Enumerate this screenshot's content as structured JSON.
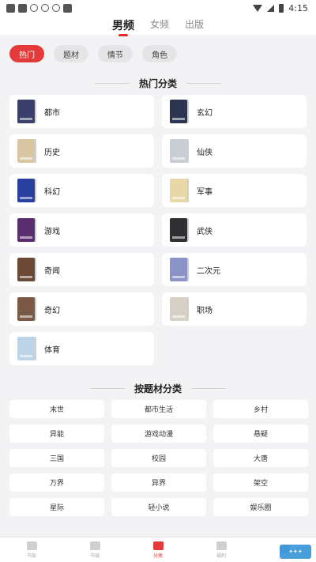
{
  "status_bar": {
    "time": "4:15"
  },
  "top_tabs": [
    {
      "label": "男频",
      "active": true
    },
    {
      "label": "女频",
      "active": false
    },
    {
      "label": "出版",
      "active": false
    }
  ],
  "filter_chips": [
    {
      "label": "热门",
      "active": true
    },
    {
      "label": "题材",
      "active": false
    },
    {
      "label": "情节",
      "active": false
    },
    {
      "label": "角色",
      "active": false
    }
  ],
  "hot_section": {
    "title": "热门分类",
    "items": [
      {
        "label": "都市",
        "cover_color": "#3a3f6b"
      },
      {
        "label": "玄幻",
        "cover_color": "#2c3550"
      },
      {
        "label": "历史",
        "cover_color": "#d9c7a3"
      },
      {
        "label": "仙侠",
        "cover_color": "#c9cdd4"
      },
      {
        "label": "科幻",
        "cover_color": "#2b3f9e"
      },
      {
        "label": "军事",
        "cover_color": "#e8d8a6"
      },
      {
        "label": "游戏",
        "cover_color": "#5a2d6e"
      },
      {
        "label": "武侠",
        "cover_color": "#2e2e33"
      },
      {
        "label": "奇闻",
        "cover_color": "#6a4a36"
      },
      {
        "label": "二次元",
        "cover_color": "#8b92c8"
      },
      {
        "label": "奇幻",
        "cover_color": "#7a5a46"
      },
      {
        "label": "职场",
        "cover_color": "#d6d0c6"
      },
      {
        "label": "体育",
        "cover_color": "#bcd4e6"
      }
    ]
  },
  "theme_section": {
    "title": "按题材分类",
    "items": [
      "末世",
      "都市生活",
      "乡村",
      "异能",
      "游戏动漫",
      "悬疑",
      "三国",
      "校园",
      "大唐",
      "万界",
      "异界",
      "架空",
      "星际",
      "轻小说",
      "娱乐圈"
    ]
  },
  "bottom_nav": [
    {
      "label": "书架",
      "active": false
    },
    {
      "label": "书城",
      "active": false
    },
    {
      "label": "分类",
      "active": true
    },
    {
      "label": "福利",
      "active": false
    },
    {
      "label": "",
      "active": false
    }
  ],
  "colors": {
    "accent": "#e53a3a",
    "background": "#f3f3f5"
  }
}
